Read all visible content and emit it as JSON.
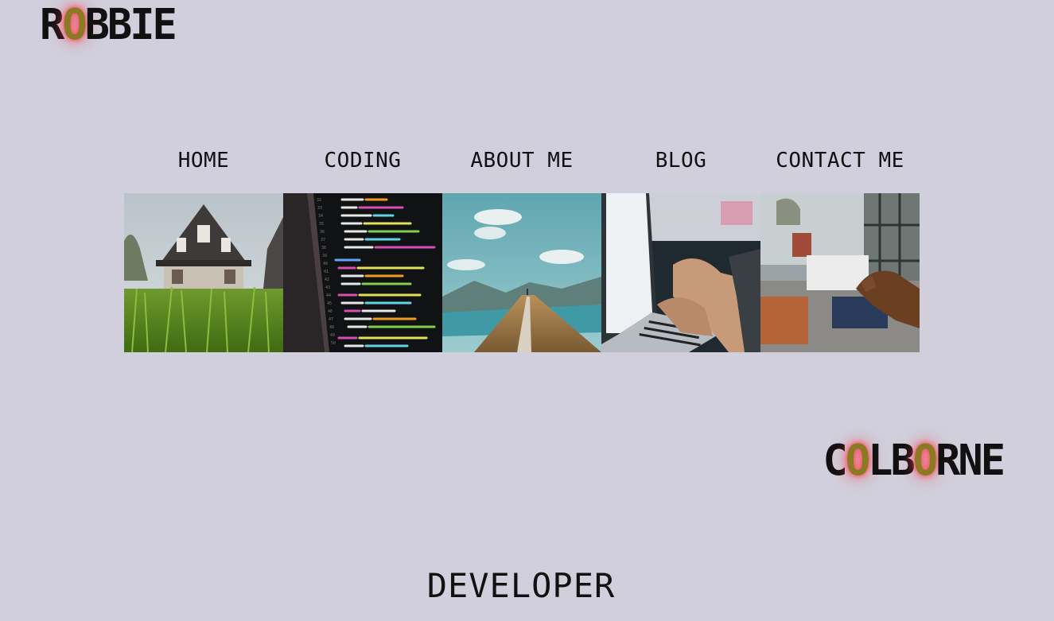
{
  "brand_top": {
    "part1": "R",
    "glow": "O",
    "part2": "BBIE"
  },
  "nav": {
    "items": [
      {
        "label": "HOME"
      },
      {
        "label": "CODING"
      },
      {
        "label": "ABOUT ME"
      },
      {
        "label": "BLOG"
      },
      {
        "label": "CONTACT ME"
      }
    ]
  },
  "tiles": [
    {
      "icon": "house-photo"
    },
    {
      "icon": "code-screen-photo"
    },
    {
      "icon": "mountain-ridge-photo"
    },
    {
      "icon": "laptop-typing-photo"
    },
    {
      "icon": "business-card-photo"
    }
  ],
  "brand_bottom": {
    "part1": "C",
    "glow1": "O",
    "part2": "LB",
    "glow2": "O",
    "part3": "RNE"
  },
  "role": "DEVELOPER",
  "colors": {
    "background": "#d0cfdb",
    "brand_text": "#111111",
    "brand_glow_letter": "#8a7a22",
    "brand_glow": "#ff3c50"
  }
}
